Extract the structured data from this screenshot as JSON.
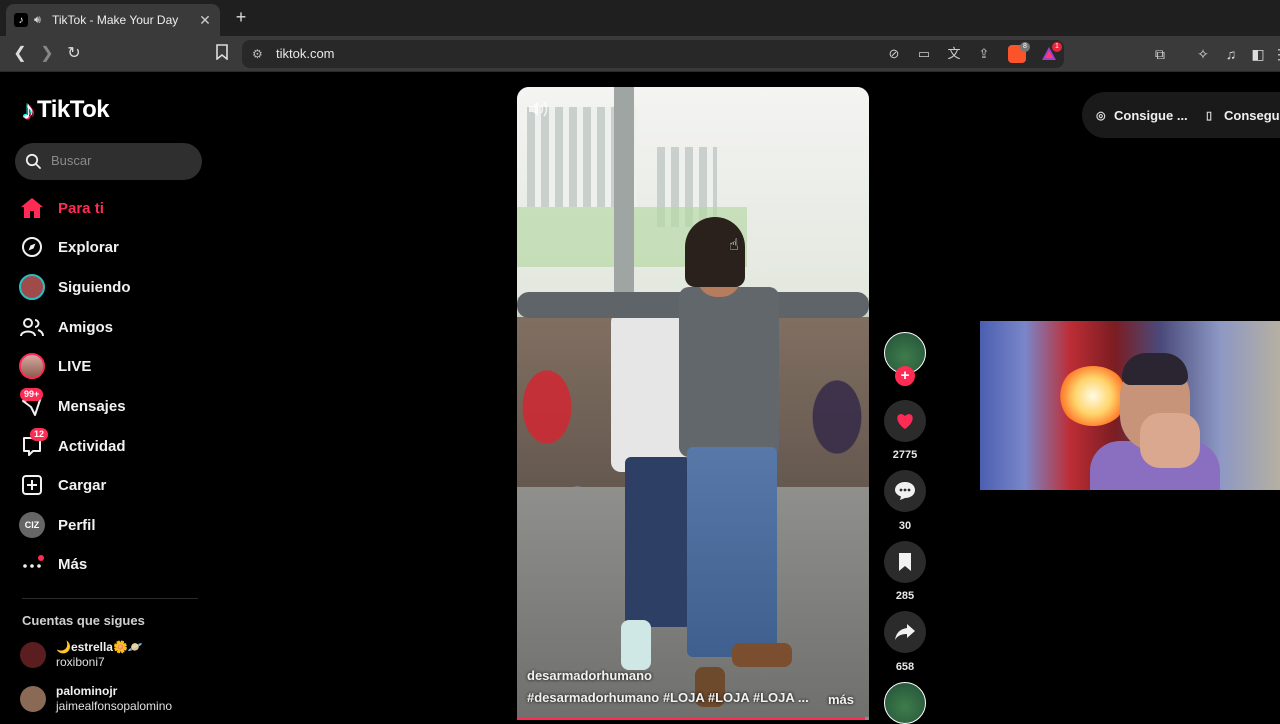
{
  "browser": {
    "tab_title": "TikTok - Make Your Day",
    "url": "tiktok.com",
    "brave_shield_count": "8",
    "rewards_count": "1"
  },
  "app": {
    "name": "TikTok"
  },
  "search": {
    "placeholder": "Buscar"
  },
  "menu": [
    {
      "label": "Para ti",
      "icon": "home-icon",
      "active": true
    },
    {
      "label": "Explorar",
      "icon": "compass-icon"
    },
    {
      "label": "Siguiendo",
      "icon": "following-avatar"
    },
    {
      "label": "Amigos",
      "icon": "friends-icon"
    },
    {
      "label": "LIVE",
      "icon": "live-avatar"
    },
    {
      "label": "Mensajes",
      "icon": "messages-icon",
      "badge": "99+"
    },
    {
      "label": "Actividad",
      "icon": "activity-icon",
      "badge": "12"
    },
    {
      "label": "Cargar",
      "icon": "upload-icon"
    },
    {
      "label": "Perfil",
      "icon": "profile-avatar",
      "avatar_text": "CIZ"
    },
    {
      "label": "Más",
      "icon": "more-icon"
    }
  ],
  "following": {
    "title": "Cuentas que sigues",
    "accounts": [
      {
        "display": "🌙estrella🌼🪐",
        "handle": "roxiboni7"
      },
      {
        "display": "palominojr",
        "handle": "jaimealfonsopalomino"
      }
    ]
  },
  "video": {
    "author": "desarmadorhumano",
    "tags": "#desarmadorhumano #LOJA #LOJA #LOJA ...",
    "more": "más",
    "progress": 0.99
  },
  "actions": {
    "likes": "2775",
    "comments": "30",
    "saves": "285",
    "shares": "658"
  },
  "get_app": {
    "coins_label": "Consigue ...",
    "app_label": "Conseguir"
  },
  "colors": {
    "accent": "#fe2c55",
    "cyan": "#25f4ee",
    "background": "#000000"
  }
}
